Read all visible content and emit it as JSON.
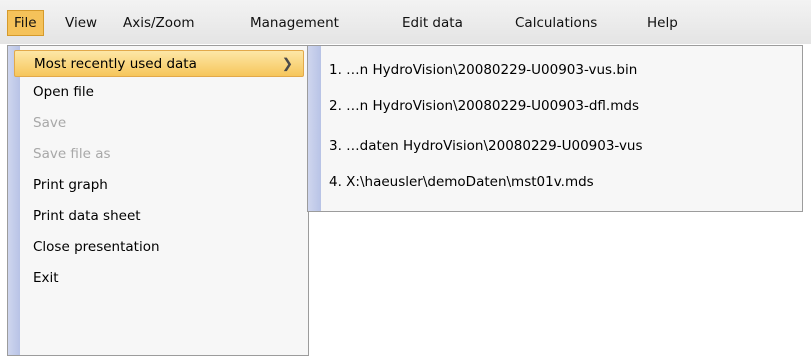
{
  "menubar": {
    "items": [
      "File",
      "View",
      "Axis/Zoom",
      "Management",
      "Edit data",
      "Calculations",
      "Help"
    ]
  },
  "file_menu": {
    "items": [
      {
        "label": "Most recently used data",
        "state": "highlighted",
        "submenu": true
      },
      {
        "label": "Open file",
        "state": "enabled"
      },
      {
        "label": "Save",
        "state": "disabled"
      },
      {
        "label": "Save file as",
        "state": "disabled"
      },
      {
        "label": "Print graph",
        "state": "enabled"
      },
      {
        "label": "Print data sheet",
        "state": "enabled"
      },
      {
        "label": "Close presentation",
        "state": "enabled"
      },
      {
        "label": "Exit",
        "state": "enabled"
      }
    ],
    "submenu_chevron": "❯"
  },
  "recent_files": {
    "items": [
      "1. …n HydroVision\\20080229-U00903-vus.bin",
      "2. …n HydroVision\\20080229-U00903-dfl.mds",
      "3. …daten HydroVision\\20080229-U00903-vus",
      "4. X:\\haeusler\\demoDaten\\mst01v.mds"
    ]
  },
  "colors": {
    "highlight_top": "#fde7a6",
    "highlight_bottom": "#f6c65b",
    "icon_strip": "#c2cbea",
    "disabled_text": "#a8a8a8"
  }
}
